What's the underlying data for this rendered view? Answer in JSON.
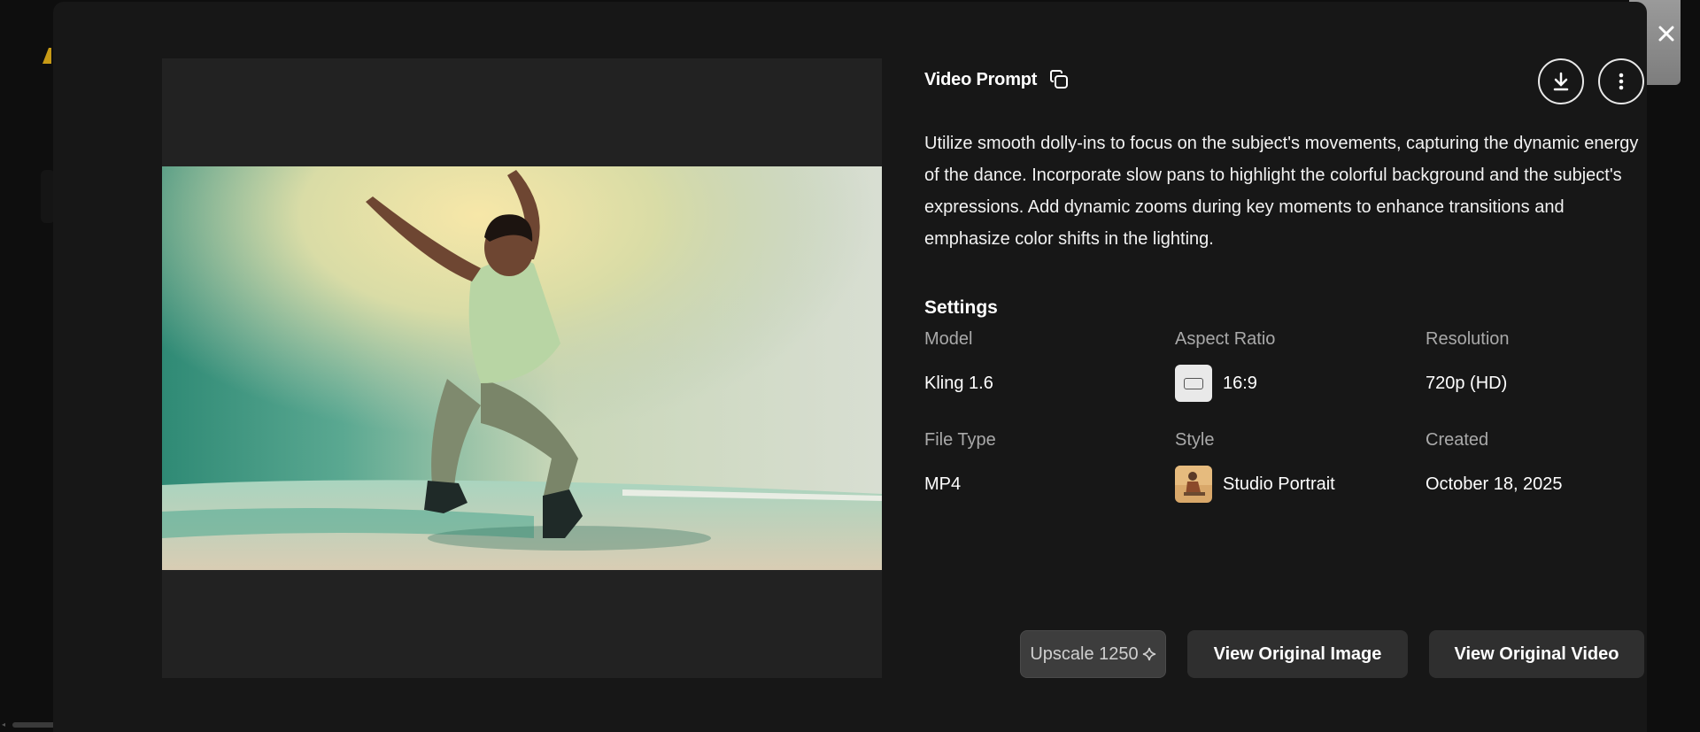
{
  "modal": {
    "prompt_title": "Video Prompt",
    "prompt_text": "Utilize smooth dolly-ins to focus on the subject's movements, capturing the dynamic energy of the dance. Incorporate slow pans to highlight the colorful background and the subject's expressions. Add dynamic zooms during key moments to enhance transitions and emphasize color shifts in the lighting.",
    "settings_title": "Settings",
    "settings": {
      "model_label": "Model",
      "model_value": "Kling 1.6",
      "aspect_label": "Aspect Ratio",
      "aspect_value": "16:9",
      "resolution_label": "Resolution",
      "resolution_value": "720p (HD)",
      "filetype_label": "File Type",
      "filetype_value": "MP4",
      "style_label": "Style",
      "style_value": "Studio Portrait",
      "created_label": "Created",
      "created_value": "October 18, 2025"
    },
    "buttons": {
      "upscale_label": "Upscale 1250",
      "view_image_label": "View Original Image",
      "view_video_label": "View Original Video"
    },
    "icons": [
      "close-icon",
      "copy-icon",
      "download-icon",
      "more-vertical-icon",
      "aspect-ratio-icon",
      "sparkle-icon"
    ]
  },
  "colors": {
    "modal_bg": "#171717",
    "page_bg": "#0e0e0e",
    "button_bg": "#2f2f2f",
    "upscale_bg": "#3d3d3d",
    "muted_text": "#a9a9a9",
    "brand_accent": "#d4a017"
  }
}
